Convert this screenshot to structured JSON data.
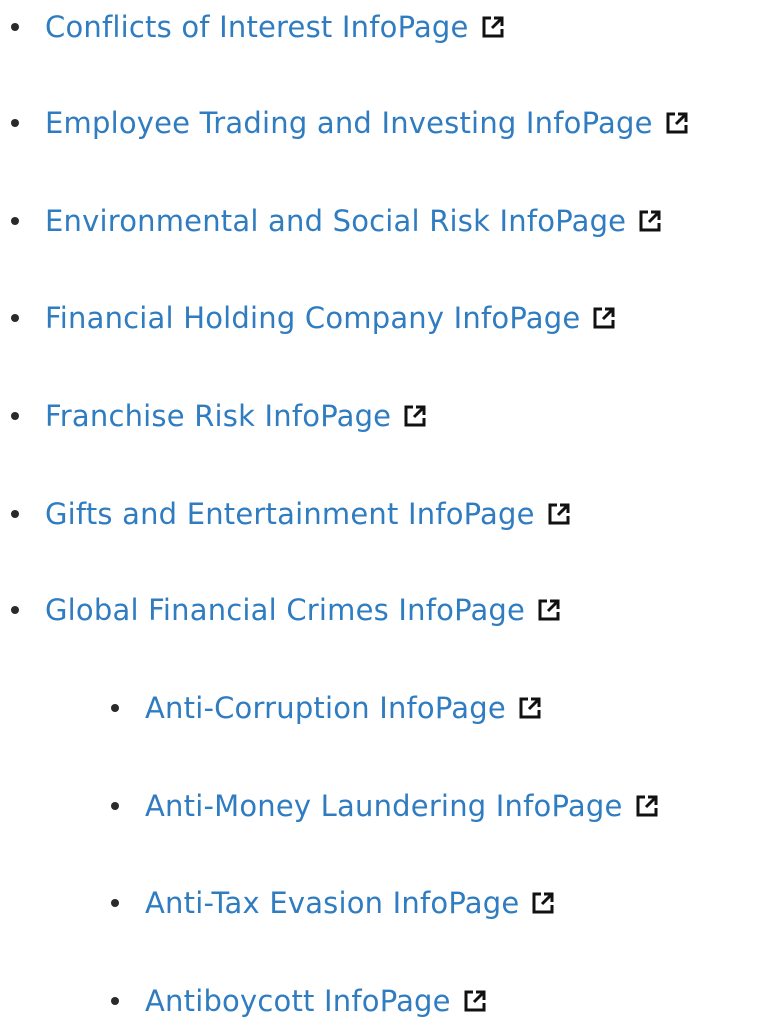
{
  "link_color": "#2f7cc1",
  "external_icon": "external-link-icon",
  "items": [
    {
      "label": "Conflicts of Interest InfoPage",
      "level": 1
    },
    {
      "label": "Employee Trading and Investing InfoPage",
      "level": 1
    },
    {
      "label": "Environmental and Social Risk InfoPage",
      "level": 1
    },
    {
      "label": "Financial Holding Company InfoPage",
      "level": 1
    },
    {
      "label": "Franchise Risk InfoPage",
      "level": 1
    },
    {
      "label": "Gifts and Entertainment InfoPage",
      "level": 1
    },
    {
      "label": "Global Financial Crimes InfoPage",
      "level": 1
    },
    {
      "label": "Anti-Corruption InfoPage",
      "level": 2
    },
    {
      "label": "Anti-Money Laundering InfoPage",
      "level": 2
    },
    {
      "label": "Anti-Tax Evasion InfoPage",
      "level": 2
    },
    {
      "label": "Antiboycott InfoPage",
      "level": 2
    }
  ]
}
